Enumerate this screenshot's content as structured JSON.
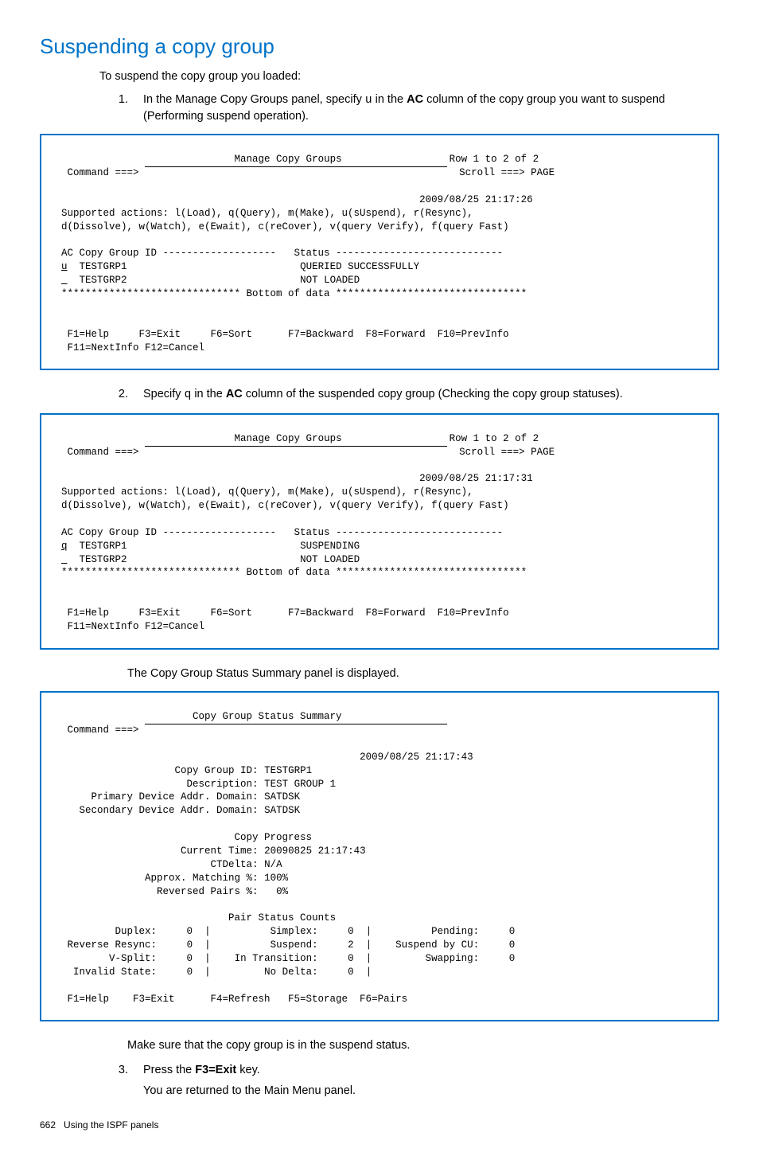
{
  "heading": "Suspending a copy group",
  "intro": "To suspend the copy group you loaded:",
  "step1": {
    "num": "1.",
    "pre": "In the Manage Copy Groups panel, specify ",
    "action": "u",
    "mid1": " in the ",
    "bold1": "AC",
    "post": " column of the copy group you want to suspend (Performing suspend operation)."
  },
  "panel1": {
    "title": "Manage Copy Groups",
    "row_info": "Row 1 to 2 of 2",
    "cmd_label": "Command ===> ",
    "scroll": "Scroll ===> PAGE",
    "timestamp": "2009/08/25 21:17:26",
    "actions1": "Supported actions: l(Load), q(Query), m(Make), u(sUspend), r(Resync),",
    "actions2": "d(Dissolve), w(Watch), e(Ewait), c(reCover), v(query Verify), f(query Fast)",
    "hdr": "AC Copy Group ID -------------------   Status ----------------------------",
    "ac1": "u",
    "row1_id": "TESTGRP1",
    "row1_status": "QUERIED SUCCESSFULLY",
    "ac2_blank": "  ",
    "row2_id": "TESTGRP2",
    "row2_status": "NOT LOADED",
    "bottom": "****************************** Bottom of data ********************************",
    "fkeys1": " F1=Help     F3=Exit     F6=Sort      F7=Backward  F8=Forward  F10=PrevInfo",
    "fkeys2": " F11=NextInfo F12=Cancel"
  },
  "step2": {
    "num": "2.",
    "pre": "Specify ",
    "action": "q",
    "mid1": " in the ",
    "bold1": "AC",
    "post": " column of the suspended copy group (Checking the copy group statuses)."
  },
  "panel2": {
    "title": "Manage Copy Groups",
    "row_info": "Row 1 to 2 of 2",
    "cmd_label": "Command ===> ",
    "scroll": "Scroll ===> PAGE",
    "timestamp": "2009/08/25 21:17:31",
    "actions1": "Supported actions: l(Load), q(Query), m(Make), u(sUspend), r(Resync),",
    "actions2": "d(Dissolve), w(Watch), e(Ewait), c(reCover), v(query Verify), f(query Fast)",
    "hdr": "AC Copy Group ID -------------------   Status ----------------------------",
    "ac1": "q",
    "row1_id": "TESTGRP1",
    "row1_status": "SUSPENDING",
    "row2_id": "TESTGRP2",
    "row2_status": "NOT LOADED",
    "bottom": "****************************** Bottom of data ********************************",
    "fkeys1": " F1=Help     F3=Exit     F6=Sort      F7=Backward  F8=Forward  F10=PrevInfo",
    "fkeys2": " F11=NextInfo F12=Cancel"
  },
  "note_after_p2": "The Copy Group Status Summary panel is displayed.",
  "panel3": {
    "title": "Copy Group Status Summary",
    "cmd_label": "Command ===> ",
    "timestamp": "2009/08/25 21:17:43",
    "cgid_lbl": "             Copy Group ID:",
    "cgid_val": "TESTGRP1",
    "desc_lbl": "               Description:",
    "desc_val": "TEST GROUP 1",
    "pdom_lbl": "  Primary Device Addr. Domain:",
    "pdom_val": "SATDSK",
    "sdom_lbl": "Secondary Device Addr. Domain:",
    "sdom_val": "SATDSK",
    "progress_hdr": "Copy Progress",
    "ctime_lbl": "              Current Time:",
    "ctime_val": "20090825 21:17:43",
    "ctd_lbl": "                   CTDelta:",
    "ctd_val": "N/A",
    "match_lbl": "        Approx. Matching %:",
    "match_val": "100%",
    "rev_lbl": "          Reversed Pairs %:",
    "rev_val": "  0%",
    "psc_hdr": "Pair Status Counts",
    "r1c1l": "Duplex:",
    "r1c1v": "0",
    "r1c2l": "Simplex:",
    "r1c2v": "0",
    "r1c3l": "Pending:",
    "r1c3v": "0",
    "r2c1l": "Reverse Resync:",
    "r2c1v": "0",
    "r2c2l": "Suspend:",
    "r2c2v": "2",
    "r2c3l": "Suspend by CU:",
    "r2c3v": "0",
    "r3c1l": "V-Split:",
    "r3c1v": "0",
    "r3c2l": "In Transition:",
    "r3c2v": "0",
    "r3c3l": "Swapping:",
    "r3c3v": "0",
    "r4c1l": "Invalid State:",
    "r4c1v": "0",
    "r4c2l": "No Delta:",
    "r4c2v": "0",
    "fkeys": " F1=Help    F3=Exit      F4=Refresh   F5=Storage  F6=Pairs"
  },
  "note_after_p3": "Make sure that the copy group is in the suspend status.",
  "step3": {
    "num": "3.",
    "pre": "Press the ",
    "bold1": "F3=Exit",
    "post": " key.",
    "after": "You are returned to the Main Menu panel."
  },
  "footer": {
    "pagenum": "662",
    "label": "Using the ISPF panels"
  }
}
